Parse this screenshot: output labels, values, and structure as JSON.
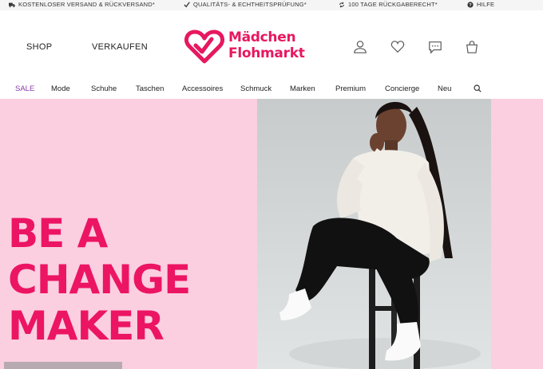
{
  "infobar": {
    "shipping": "KOSTENLOSER VERSAND & RÜCKVERSAND*",
    "quality": "QUALITÄTS- & ECHTHEITSPRÜFUNG*",
    "returns": "100 TAGE RÜCKGABERECHT*",
    "help": "HILFE"
  },
  "header": {
    "shop": "SHOP",
    "sell": "VERKAUFEN",
    "logo_line1": "Mädchen",
    "logo_line2": "Flohmarkt",
    "icons": [
      "user-icon",
      "heart-icon",
      "chat-icon",
      "bag-icon"
    ]
  },
  "nav": {
    "items": [
      "SALE",
      "Mode",
      "Schuhe",
      "Taschen",
      "Accessoires",
      "Schmuck",
      "Marken",
      "Premium",
      "Concierge",
      "Neu"
    ]
  },
  "hero": {
    "line1": "BE A",
    "line2": "CHANGE",
    "line3": "MAKER"
  },
  "colors": {
    "brand": "#e6185f",
    "hero_bg": "#fbcfe0",
    "sale": "#8b3ba8"
  }
}
